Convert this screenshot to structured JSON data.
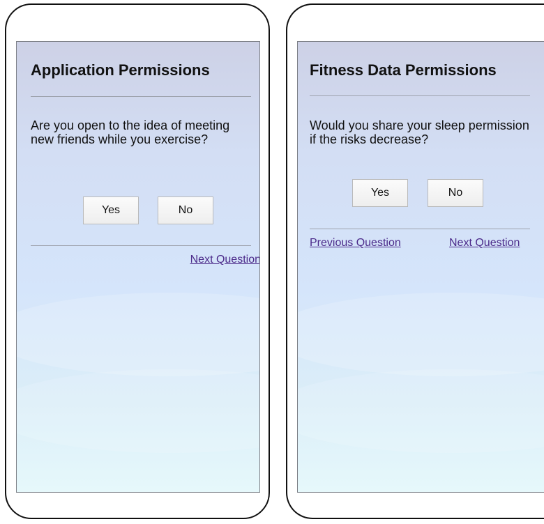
{
  "left_screen": {
    "title": "Application Permissions",
    "question": "Are you open to the idea of meeting new friends while you exercise?",
    "yes_label": "Yes",
    "no_label": "No",
    "next_label": "Next Question"
  },
  "right_screen": {
    "title": "Fitness Data Permissions",
    "question": "Would you share your sleep permission if the risks decrease?",
    "yes_label": "Yes",
    "no_label": "No",
    "previous_label": "Previous Question",
    "next_label": "Next Question"
  },
  "colors": {
    "link": "#4b2a8a",
    "screen_top": "#cdd1e6",
    "screen_bottom": "#e6f8fb"
  }
}
